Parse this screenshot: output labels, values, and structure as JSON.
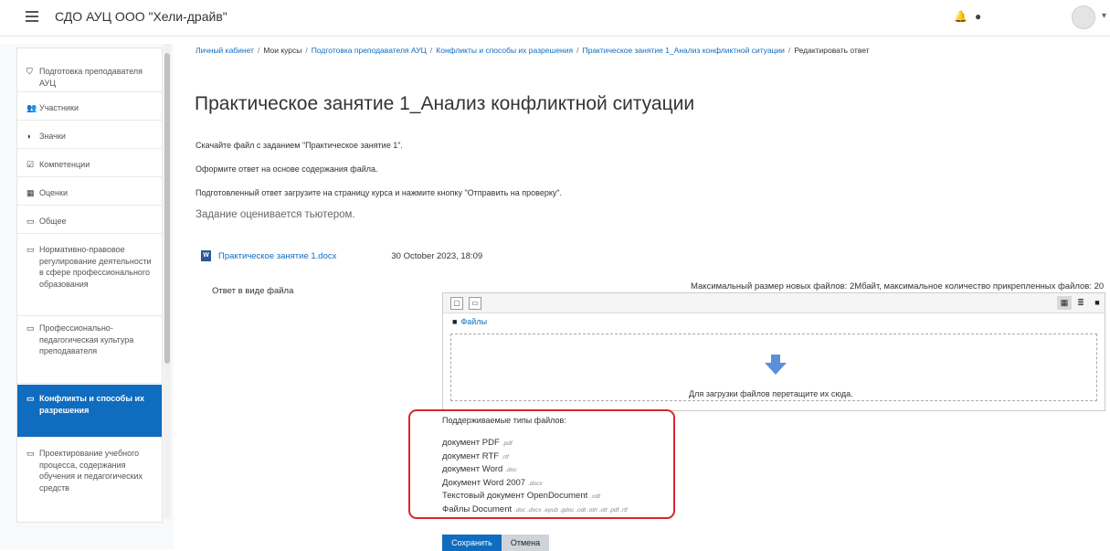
{
  "header": {
    "site_name": "СДО АУЦ ООО \"Хели-драйв\"",
    "icons": [
      "bell-icon",
      "chat-icon",
      "user-avatar"
    ]
  },
  "sidebar": {
    "items": [
      {
        "icon": "graduation-cap-icon",
        "glyph": "⛉",
        "label": "Подготовка преподавателя АУЦ"
      },
      {
        "icon": "users-icon",
        "glyph": "👥",
        "label": "Участники"
      },
      {
        "icon": "shield-icon",
        "glyph": "◗",
        "label": "Значки"
      },
      {
        "icon": "check-square-icon",
        "glyph": "☑",
        "label": "Компетенции"
      },
      {
        "icon": "table-icon",
        "glyph": "▦",
        "label": "Оценки"
      },
      {
        "icon": "folder-icon",
        "glyph": "▭",
        "label": "Общее"
      },
      {
        "icon": "folder-icon",
        "glyph": "▭",
        "label": "Нормативно-правовое регулирование деятельности в сфере профессионального образования"
      },
      {
        "icon": "folder-icon",
        "glyph": "▭",
        "label": "Профессионально-педагогическая культура преподавателя"
      },
      {
        "icon": "folder-icon",
        "glyph": "▭",
        "label": "Конфликты и способы их разрешения",
        "active": true
      },
      {
        "icon": "folder-icon",
        "glyph": "▭",
        "label": "Проектирование учебного процесса, содержания обучения и педагогических средств"
      }
    ]
  },
  "breadcrumb": [
    "Личный кабинет",
    "Мои курсы",
    "Подготовка преподавателя АУЦ",
    "Конфликты и способы их разрешения",
    "Практическое занятие 1_Анализ конфликтной ситуации",
    "Редактировать ответ"
  ],
  "main": {
    "title": "Практическое занятие 1_Анализ конфликтной ситуации",
    "instructions": [
      "Скачайте файл с заданием \"Практическое занятие 1\".",
      "Оформите ответ на основе содержания файла.",
      "Подготовленный ответ загрузите на страницу курса и нажмите кнопку \"Отправить на проверку\"."
    ],
    "grader_note": "Задание оценивается тьютером.",
    "attachment": {
      "icon_letter": "W",
      "name": "Практическое занятие 1.docx",
      "date": "30 October 2023, 18:09"
    }
  },
  "submission": {
    "answer_label": "Ответ в виде файла",
    "max_info": "Максимальный размер новых файлов: 2Мбайт, максимальное количество прикрепленных файлов: 20",
    "path_label": "Файлы",
    "drop_text": "Для загрузки файлов перетащите их сюда.",
    "supported_title": "Поддерживаемые типы файлов:",
    "supported_types": [
      {
        "name": "документ PDF",
        "ext": ".pdf"
      },
      {
        "name": "документ RTF",
        "ext": ".rtf"
      },
      {
        "name": "документ Word",
        "ext": ".doc"
      },
      {
        "name": "Документ Word 2007",
        "ext": ".docx"
      },
      {
        "name": "Текстовый документ OpenDocument",
        "ext": ".odt"
      },
      {
        "name": "Файлы Document",
        "ext": ".doc .docx .epub .gdoc .odt .oth .ott .pdf .rtf"
      }
    ]
  },
  "buttons": {
    "save": "Сохранить",
    "cancel": "Отмена"
  },
  "colors": {
    "primary": "#0f6cbf",
    "highlight_border": "#d7262e",
    "drop_arrow": "#5b8fd9"
  }
}
